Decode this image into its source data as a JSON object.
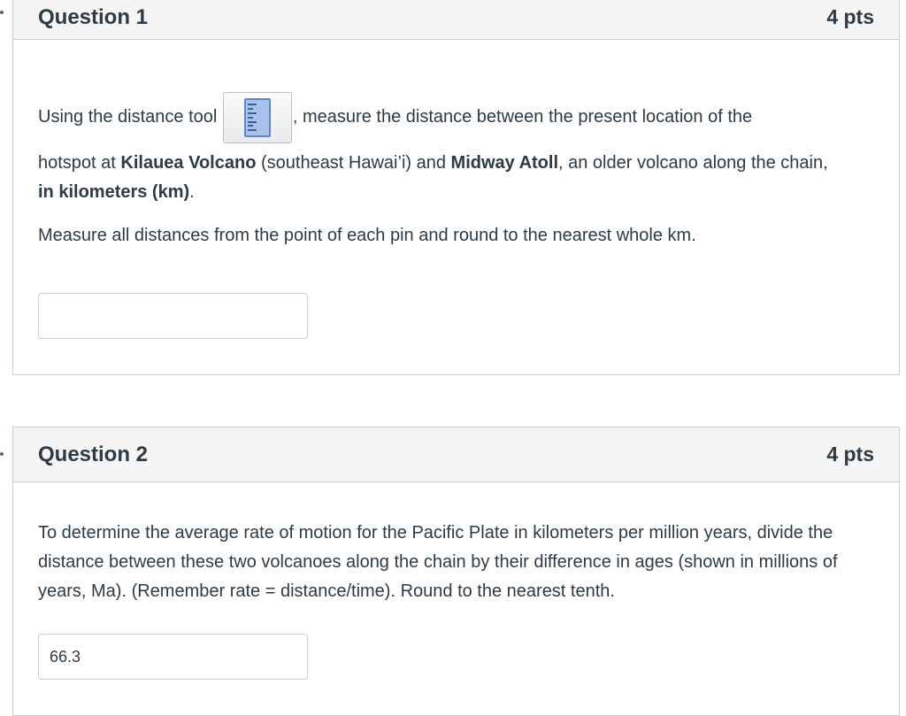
{
  "questions": [
    {
      "title": "Question 1",
      "points": "4 pts",
      "p1_before": "Using the distance tool ",
      "p1_after": ", measure the distance between the present location of the",
      "p2_a": "hotspot at ",
      "p2_b": "Kilauea Volcano",
      "p2_c": " (southeast Hawai’i) and ",
      "p2_d": "Midway Atoll",
      "p2_e": ", an older volcano along the chain,",
      "p3_bold": "in kilometers (km)",
      "p3_end": ".",
      "p4": "Measure all distances from the point of each pin and round to the nearest whole km.",
      "answer_value": "",
      "tool_icon": "ruler-icon"
    },
    {
      "title": "Question 2",
      "points": "4 pts",
      "p1": "To determine the average rate of motion for the Pacific Plate in kilometers per million years, divide the distance between these two volcanoes along the chain by their difference in ages (shown in millions of years, Ma). (Remember rate = distance/time). Round to the nearest tenth.",
      "answer_value": "66.3"
    }
  ]
}
